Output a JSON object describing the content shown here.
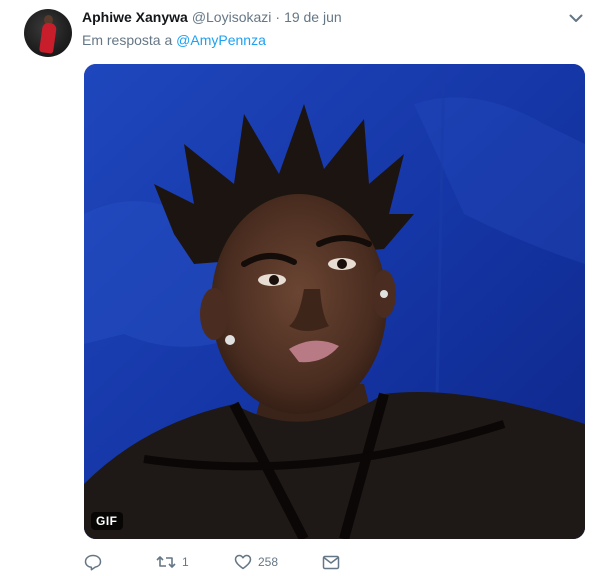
{
  "tweet": {
    "display_name": "Aphiwe Xanywa",
    "handle": "@Loyisokazi",
    "separator": "·",
    "date": "19 de jun",
    "reply_prefix": "Em resposta a",
    "reply_mention": "@AmyPennza",
    "media": {
      "type": "gif",
      "badge_label": "GIF",
      "description": "animated gif"
    },
    "actions": {
      "reply_icon": "reply-icon",
      "retweet_icon": "retweet-icon",
      "retweet_count": "1",
      "like_icon": "heart-icon",
      "like_count": "258",
      "dm_icon": "envelope-icon"
    }
  },
  "colors": {
    "text_primary": "#14171a",
    "text_secondary": "#657786",
    "link": "#1da1f2",
    "media_background": "#1432a0"
  }
}
